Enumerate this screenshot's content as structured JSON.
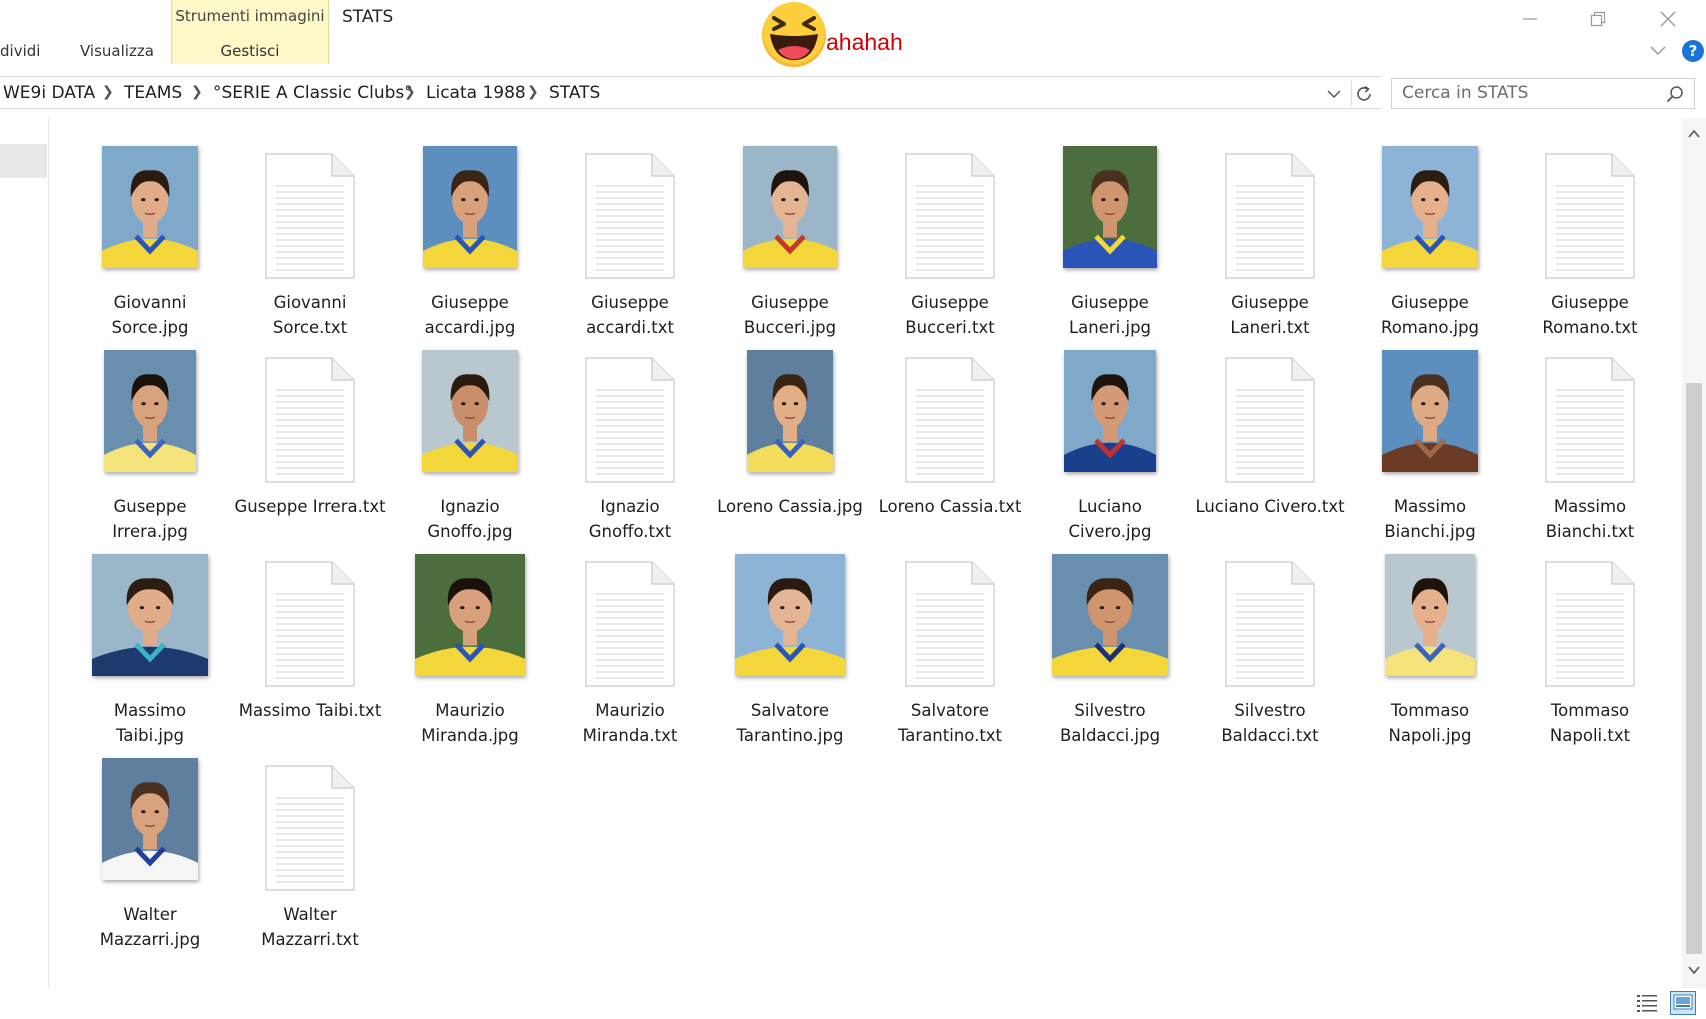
{
  "ribbon": {
    "tab_dividi": "dividi",
    "tab_visualizza": "Visualizza",
    "context_title": "Strumenti immagini",
    "context_tab": "Gestisci"
  },
  "window": {
    "title": "STATS"
  },
  "sticker": {
    "text": "ahahah",
    "icon": "laughing-emoji-icon"
  },
  "breadcrumb": [
    "WE9i DATA",
    "TEAMS",
    "°SERIE A Classic Clubs°",
    "Licata 1988",
    "STATS"
  ],
  "search": {
    "placeholder": "Cerca in STATS"
  },
  "files": [
    {
      "l1": "Giovanni",
      "l2": "Sorce.jpg",
      "kind": "img"
    },
    {
      "l1": "Giovanni",
      "l2": "Sorce.txt",
      "kind": "txt"
    },
    {
      "l1": "Giuseppe",
      "l2": "accardi.jpg",
      "kind": "img"
    },
    {
      "l1": "Giuseppe",
      "l2": "accardi.txt",
      "kind": "txt"
    },
    {
      "l1": "Giuseppe",
      "l2": "Bucceri.jpg",
      "kind": "img"
    },
    {
      "l1": "Giuseppe",
      "l2": "Bucceri.txt",
      "kind": "txt"
    },
    {
      "l1": "Giuseppe",
      "l2": "Laneri.jpg",
      "kind": "img"
    },
    {
      "l1": "Giuseppe",
      "l2": "Laneri.txt",
      "kind": "txt"
    },
    {
      "l1": "Giuseppe",
      "l2": "Romano.jpg",
      "kind": "img"
    },
    {
      "l1": "Giuseppe",
      "l2": "Romano.txt",
      "kind": "txt"
    },
    {
      "l1": "Guseppe",
      "l2": "Irrera.jpg",
      "kind": "img"
    },
    {
      "l1": "Guseppe Irrera.txt",
      "l2": "",
      "kind": "txt"
    },
    {
      "l1": "Ignazio",
      "l2": "Gnoffo.jpg",
      "kind": "img"
    },
    {
      "l1": "Ignazio",
      "l2": "Gnoffo.txt",
      "kind": "txt"
    },
    {
      "l1": "Loreno Cassia.jpg",
      "l2": "",
      "kind": "img"
    },
    {
      "l1": "Loreno Cassia.txt",
      "l2": "",
      "kind": "txt"
    },
    {
      "l1": "Luciano",
      "l2": "Civero.jpg",
      "kind": "img"
    },
    {
      "l1": "Luciano Civero.txt",
      "l2": "",
      "kind": "txt"
    },
    {
      "l1": "Massimo",
      "l2": "Bianchi.jpg",
      "kind": "img"
    },
    {
      "l1": "Massimo",
      "l2": "Bianchi.txt",
      "kind": "txt"
    },
    {
      "l1": "Massimo",
      "l2": "Taibi.jpg",
      "kind": "img"
    },
    {
      "l1": "Massimo Taibi.txt",
      "l2": "",
      "kind": "txt"
    },
    {
      "l1": "Maurizio",
      "l2": "Miranda.jpg",
      "kind": "img"
    },
    {
      "l1": "Maurizio",
      "l2": "Miranda.txt",
      "kind": "txt"
    },
    {
      "l1": "Salvatore",
      "l2": "Tarantino.jpg",
      "kind": "img"
    },
    {
      "l1": "Salvatore",
      "l2": "Tarantino.txt",
      "kind": "txt"
    },
    {
      "l1": "Silvestro",
      "l2": "Baldacci.jpg",
      "kind": "img"
    },
    {
      "l1": "Silvestro",
      "l2": "Baldacci.txt",
      "kind": "txt"
    },
    {
      "l1": "Tommaso",
      "l2": "Napoli.jpg",
      "kind": "img"
    },
    {
      "l1": "Tommaso",
      "l2": "Napoli.txt",
      "kind": "txt"
    },
    {
      "l1": "Walter",
      "l2": "Mazzarri.jpg",
      "kind": "img"
    },
    {
      "l1": "Walter",
      "l2": "Mazzarri.txt",
      "kind": "txt"
    }
  ],
  "colors": {
    "context_tab_bg": "#fcf8c7",
    "accent_blue": "#1a73d8",
    "sticker_text": "#d40000",
    "kit_yellow": "#f2d63a",
    "kit_blue": "#2a55b8"
  }
}
